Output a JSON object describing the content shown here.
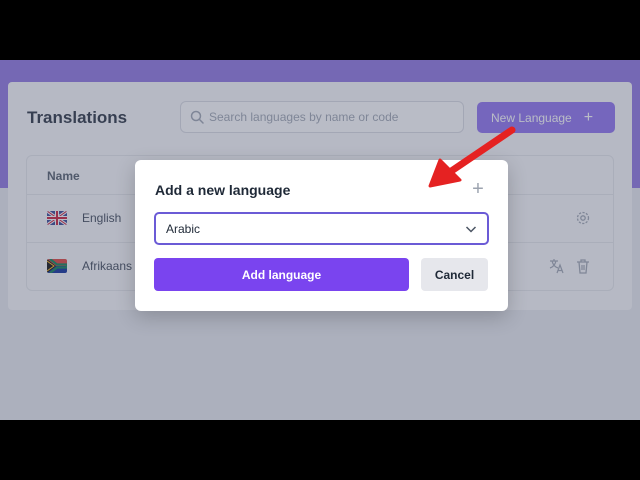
{
  "page": {
    "title": "Translations",
    "search_placeholder": "Search languages by name or code",
    "new_language_label": "New Language",
    "new_language_icon": "plus-icon"
  },
  "table": {
    "column_name": "Name",
    "rows": [
      {
        "flag": "uk-flag-icon",
        "label": "English"
      },
      {
        "flag": "south-africa-flag-icon",
        "label": "Afrikaans"
      }
    ]
  },
  "modal": {
    "title": "Add a new language",
    "close_icon": "plus-icon",
    "selected_language": "Arabic",
    "add_label": "Add language",
    "cancel_label": "Cancel"
  },
  "colors": {
    "header_band": "#8b6fe0",
    "primary_button": "#7a44ef",
    "select_border": "#6b5bd6",
    "annotation_arrow": "#e52222"
  }
}
